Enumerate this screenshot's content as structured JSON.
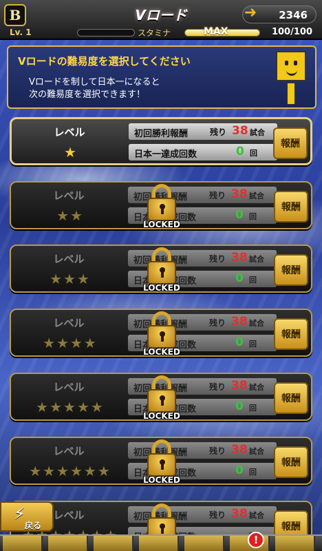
{
  "header": {
    "logo": "B",
    "title": "Vロード",
    "currency": "2346",
    "level": "Lv. 1",
    "stamina_label": "スタミナ",
    "stamina_max_label": "MAX",
    "stamina_value": "100/100"
  },
  "banner": {
    "title": "Vロードの難易度を選択してください",
    "line1": "Vロードを制して日本一になると",
    "line2": "次の難易度を選択できます！"
  },
  "labels": {
    "level": "レベル",
    "first_win_reward": "初回勝利報酬",
    "remaining": "残り",
    "matches_unit": "試合",
    "champion_count": "日本一達成回数",
    "times_unit": "回",
    "reward_button": "報酬",
    "locked": "LOCKED"
  },
  "levels": [
    {
      "stars": "★",
      "remaining": "38",
      "count": "0",
      "locked": false
    },
    {
      "stars": "★★",
      "remaining": "38",
      "count": "0",
      "locked": true
    },
    {
      "stars": "★★★",
      "remaining": "38",
      "count": "0",
      "locked": true
    },
    {
      "stars": "★★★★",
      "remaining": "38",
      "count": "0",
      "locked": true
    },
    {
      "stars": "★★★★★",
      "remaining": "38",
      "count": "0",
      "locked": true
    },
    {
      "stars": "★★★★★★",
      "remaining": "38",
      "count": "0",
      "locked": true
    },
    {
      "stars": "★★★★★★★",
      "remaining": "38",
      "count": "",
      "locked": true
    }
  ],
  "footer": {
    "back_label": "戻る",
    "back_icon": "lightning-icon",
    "alert_badge": "!"
  },
  "colors": {
    "accent_gold": "#e3b84a",
    "remaining_red": "#e23030",
    "count_green": "#3bc23b"
  }
}
